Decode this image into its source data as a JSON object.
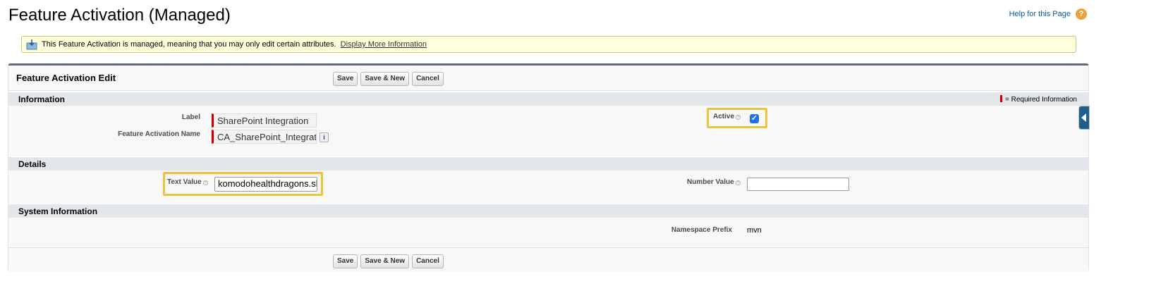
{
  "header": {
    "title": "Feature Activation (Managed)",
    "help_link": "Help for this Page",
    "help_icon": "?"
  },
  "banner": {
    "icon": "managed-package-icon",
    "message": "This Feature Activation is managed, meaning that you may only edit certain attributes.",
    "link": "Display More Information"
  },
  "edit_panel": {
    "title": "Feature Activation Edit",
    "buttons": {
      "save": "Save",
      "save_new": "Save & New",
      "cancel": "Cancel"
    }
  },
  "sections": {
    "information": {
      "title": "Information",
      "required_legend": "= Required Information",
      "label_field": {
        "label": "Label",
        "value": "SharePoint Integration"
      },
      "name_field": {
        "label": "Feature Activation Name",
        "value": "CA_SharePoint_Integrat",
        "info_icon": "i"
      },
      "active_field": {
        "label": "Active",
        "checked": true,
        "check_glyph": "✓"
      }
    },
    "details": {
      "title": "Details",
      "text_value": {
        "label": "Text Value",
        "value": "komodohealthdragons.sl"
      },
      "number_value": {
        "label": "Number Value",
        "value": ""
      }
    },
    "system": {
      "title": "System Information",
      "namespace": {
        "label": "Namespace Prefix",
        "value": "mvn"
      }
    }
  },
  "colors": {
    "highlight": "#f2c13a",
    "required": "#cc0000",
    "banner_bg": "#ffffdc",
    "section_bar": "#e3e6ea",
    "checkbox": "#1a73e8"
  }
}
